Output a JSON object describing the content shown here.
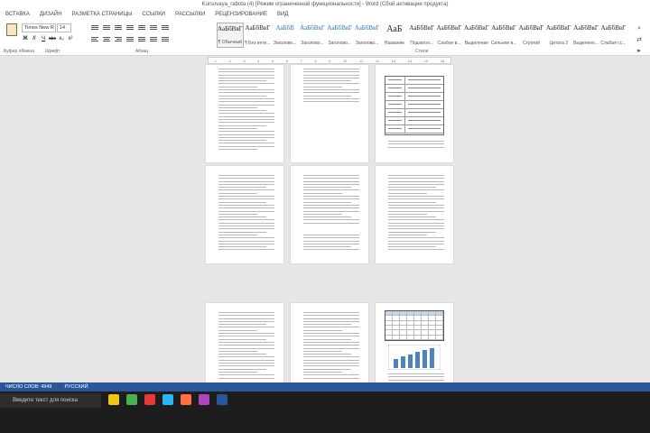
{
  "window": {
    "title": "Kursovaya_rabota (4) [Режим ограниченной функциональности] - Word (Сбой активации продукта)"
  },
  "ribbon": {
    "tabs": [
      "Вставка",
      "Дизайн",
      "Разметка страницы",
      "Ссылки",
      "Рассылки",
      "Рецензирование",
      "Вид"
    ],
    "active_tab_index": -1,
    "clipboard_label": "Буфер обмена",
    "font_name": "Times New R",
    "font_size": "14",
    "font_group_label": "Шрифт",
    "paragraph_group_label": "Абзац",
    "styles_group_label": "Стили",
    "format_buttons": [
      "Ж",
      "К",
      "Ч",
      "abc",
      "x₂",
      "x²"
    ],
    "styles": [
      {
        "sample": "АаБбВвГ",
        "name": "¶ Обычный",
        "big": false,
        "blue": false,
        "selected": true
      },
      {
        "sample": "АаБбВвГ",
        "name": "¶ Без инте...",
        "big": false,
        "blue": false,
        "selected": false
      },
      {
        "sample": "АаБбВ",
        "name": "Заголово...",
        "big": false,
        "blue": true,
        "selected": false
      },
      {
        "sample": "АаБбВвГ",
        "name": "Заголово...",
        "big": false,
        "blue": true,
        "selected": false
      },
      {
        "sample": "АаБбВвГ",
        "name": "Заголово...",
        "big": false,
        "blue": true,
        "selected": false
      },
      {
        "sample": "АаБбВвГ",
        "name": "Заголово...",
        "big": false,
        "blue": true,
        "selected": false
      },
      {
        "sample": "АаБ",
        "name": "Название",
        "big": true,
        "blue": false,
        "selected": false
      },
      {
        "sample": "АаБбВвГ",
        "name": "Подзагол...",
        "big": false,
        "blue": false,
        "selected": false
      },
      {
        "sample": "АаБбВвГ",
        "name": "Слабое в...",
        "big": false,
        "blue": false,
        "selected": false
      },
      {
        "sample": "АаБбВвГ",
        "name": "Выделение",
        "big": false,
        "blue": false,
        "selected": false
      },
      {
        "sample": "АаБбВвГ",
        "name": "Сильное в...",
        "big": false,
        "blue": false,
        "selected": false
      },
      {
        "sample": "АаБбВвГ",
        "name": "Строгий",
        "big": false,
        "blue": false,
        "selected": false
      },
      {
        "sample": "АаБбВвГ",
        "name": "Цитата 2",
        "big": false,
        "blue": false,
        "selected": false
      },
      {
        "sample": "АаБбВвГ",
        "name": "Выделенн...",
        "big": false,
        "blue": false,
        "selected": false
      },
      {
        "sample": "АаБбВвГ",
        "name": "Слабая сс...",
        "big": false,
        "blue": false,
        "selected": false
      }
    ]
  },
  "ruler": {
    "ticks": [
      "1",
      "2",
      "3",
      "4",
      "5",
      "6",
      "7",
      "8",
      "9",
      "10",
      "11",
      "12",
      "13",
      "14",
      "15",
      "16"
    ]
  },
  "statusbar": {
    "words": "ЧИСЛО СЛОВ: 4949",
    "language": "РУССКИЙ"
  },
  "taskbar": {
    "search_placeholder": "Введите текст для поиска",
    "icon_colors": [
      "#f0c419",
      "#4caf50",
      "#e53935",
      "#29b6f6",
      "#ff7043",
      "#ab47bc",
      "#2b579a"
    ]
  }
}
